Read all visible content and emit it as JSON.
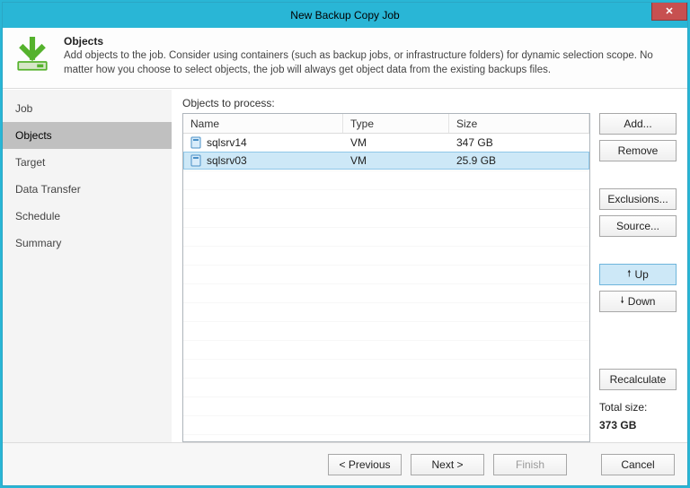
{
  "window": {
    "title": "New Backup Copy Job"
  },
  "header": {
    "title": "Objects",
    "description": "Add objects to the job. Consider using containers (such as backup jobs, or infrastructure folders) for dynamic selection scope. No matter how you choose to select objects, the job will always get object data from the existing backups files."
  },
  "nav": {
    "items": [
      {
        "label": "Job"
      },
      {
        "label": "Objects",
        "selected": true
      },
      {
        "label": "Target"
      },
      {
        "label": "Data Transfer"
      },
      {
        "label": "Schedule"
      },
      {
        "label": "Summary"
      }
    ]
  },
  "objects_label": "Objects to process:",
  "columns": {
    "name": "Name",
    "type": "Type",
    "size": "Size"
  },
  "rows": [
    {
      "name": "sqlsrv14",
      "type": "VM",
      "size": "347 GB",
      "selected": false
    },
    {
      "name": "sqlsrv03",
      "type": "VM",
      "size": "25.9 GB",
      "selected": true
    }
  ],
  "side": {
    "add": "Add...",
    "remove": "Remove",
    "exclusions": "Exclusions...",
    "source": "Source...",
    "up": "Up",
    "down": "Down",
    "recalculate": "Recalculate",
    "total_label": "Total size:",
    "total_value": "373 GB"
  },
  "footer": {
    "previous": "< Previous",
    "next": "Next >",
    "finish": "Finish",
    "cancel": "Cancel"
  }
}
